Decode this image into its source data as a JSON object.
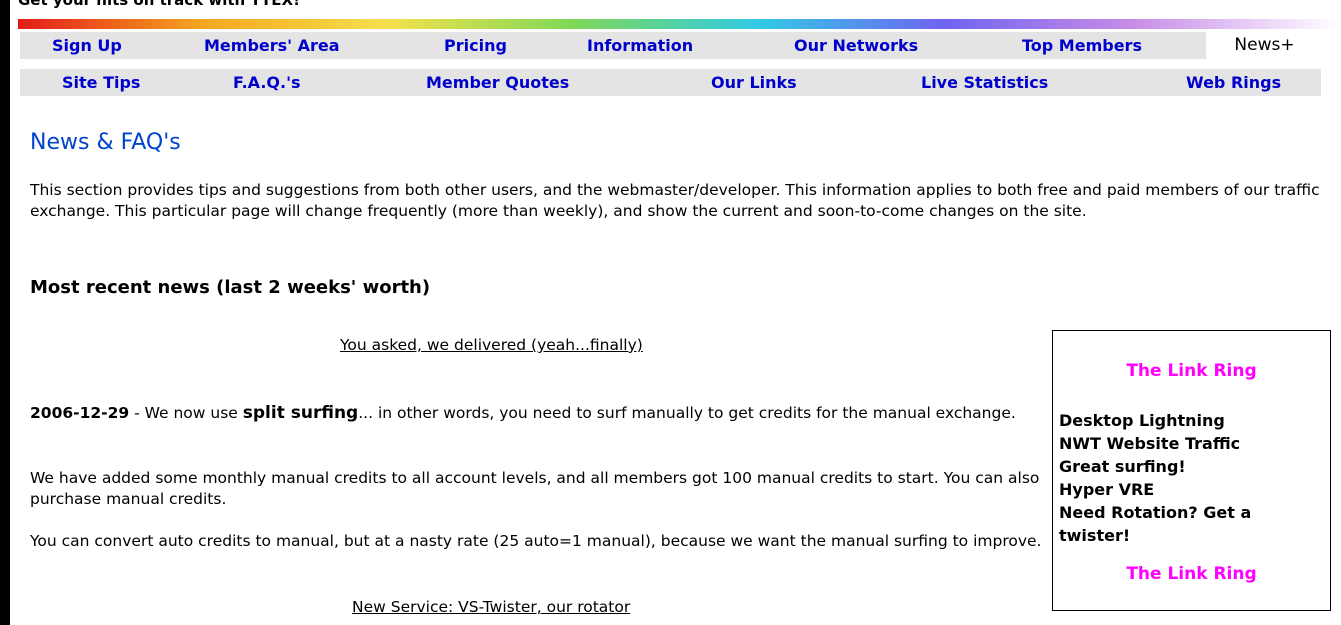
{
  "banner": {
    "text": "Get your hits on track with TTEX!"
  },
  "nav": {
    "row1": [
      "Sign Up",
      "Members' Area",
      "Pricing",
      "Information",
      "Our Networks",
      "Top Members"
    ],
    "active_tab": "News+",
    "row2": [
      "Site Tips",
      "F.A.Q.'s",
      "Member Quotes",
      "Our Links",
      "Live Statistics",
      "Web Rings"
    ]
  },
  "main": {
    "title": "News & FAQ's",
    "intro": "This section provides tips and suggestions from both other users, and the webmaster/developer.  This information applies to both free and paid members of our traffic exchange.  This particular page will change frequently (more than weekly), and show the current and soon-to-come changes on the site.",
    "section_heading": "Most recent news (last 2 weeks' worth)"
  },
  "news": {
    "item1_link": "You asked, we delivered (yeah...finally)",
    "date": "2006-12-29",
    "p1_pre": " - We now use ",
    "p1_keyword": "split surfing",
    "p1_post": "... in other words, you need to surf manually to get credits for the manual exchange.",
    "p2": "We have added some monthly manual credits to all account levels, and all members got 100 manual credits to start. You can also purchase manual credits.",
    "p3": "You can convert auto credits to manual, but at a nasty rate (25 auto=1 manual), because we want the manual surfing to improve.",
    "item2_link": "New Service: VS-Twister, our rotator"
  },
  "link_ring": {
    "title_top": "The Link Ring",
    "items": [
      "Desktop Lightning",
      "NWT Website Traffic",
      "Great surfing!",
      "Hyper VRE",
      "Need Rotation? Get a twister!"
    ],
    "title_bottom": "The Link Ring"
  },
  "colors": {
    "nav_link": "#0000cc",
    "title": "#0044cc",
    "ring_title": "#ff00ff",
    "nav_bg": "#e4e4e4"
  }
}
